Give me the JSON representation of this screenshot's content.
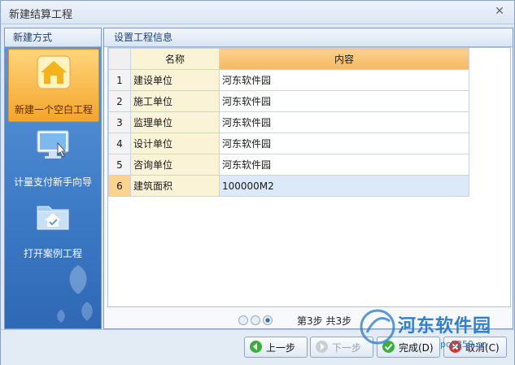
{
  "window": {
    "title": "新建结算工程"
  },
  "left": {
    "header": "新建方式",
    "items": [
      {
        "label": "新建一个空白工程",
        "icon": "house-icon",
        "active": true
      },
      {
        "label": "计量支付新手向导",
        "icon": "monitor-pointer-icon",
        "active": false
      },
      {
        "label": "打开案例工程",
        "icon": "folder-house-icon",
        "active": false
      }
    ]
  },
  "right": {
    "header": "设置工程信息",
    "columns": [
      "名称",
      "内容"
    ],
    "rows": [
      {
        "num": "1",
        "name": "建设单位",
        "value": "河东软件园"
      },
      {
        "num": "2",
        "name": "施工单位",
        "value": "河东软件园"
      },
      {
        "num": "3",
        "name": "监理单位",
        "value": "河东软件园"
      },
      {
        "num": "4",
        "name": "设计单位",
        "value": "河东软件园"
      },
      {
        "num": "5",
        "name": "咨询单位",
        "value": "河东软件园"
      },
      {
        "num": "6",
        "name": "建筑面积",
        "value": "100000M2"
      }
    ],
    "step_text": "第3步 共3步"
  },
  "buttons": {
    "prev": "上一步",
    "next": "下一步",
    "finish": "完成(D)",
    "cancel": "取消(C)"
  },
  "watermark": {
    "text": "河东软件园",
    "url": "pc0359.cn"
  },
  "colors": {
    "accent_orange": "#f5b760",
    "selected_row": "#dbe9f9",
    "panel_blue": "#3f7fc9"
  }
}
